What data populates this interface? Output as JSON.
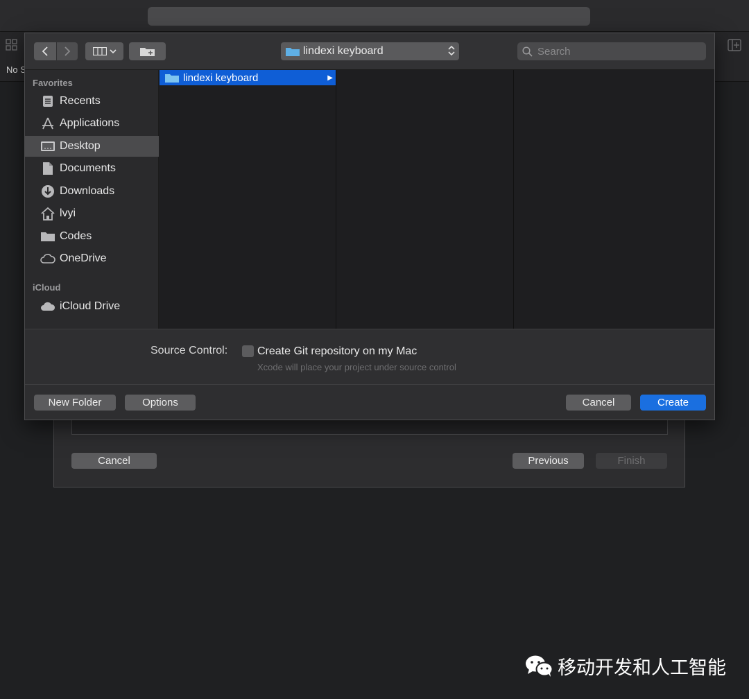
{
  "background_window": {
    "no_selection_text": "No S",
    "wizard": {
      "cancel_label": "Cancel",
      "previous_label": "Previous",
      "finish_label": "Finish"
    }
  },
  "panel": {
    "toolbar": {
      "back_icon": "chevron-left-icon",
      "forward_icon": "chevron-right-icon",
      "view_mode_icon": "column-view-icon",
      "new_folder_icon": "new-folder-icon",
      "path_popup_label": "lindexi keyboard",
      "search_placeholder": "Search"
    },
    "sidebar": {
      "sections": [
        {
          "heading": "Favorites",
          "items": [
            {
              "label": "Recents",
              "icon": "recents-icon",
              "selected": false
            },
            {
              "label": "Applications",
              "icon": "applications-icon",
              "selected": false
            },
            {
              "label": "Desktop",
              "icon": "desktop-icon",
              "selected": true
            },
            {
              "label": "Documents",
              "icon": "documents-icon",
              "selected": false
            },
            {
              "label": "Downloads",
              "icon": "downloads-icon",
              "selected": false
            },
            {
              "label": "lvyi",
              "icon": "home-icon",
              "selected": false
            },
            {
              "label": "Codes",
              "icon": "folder-icon",
              "selected": false
            },
            {
              "label": "OneDrive",
              "icon": "cloud-icon",
              "selected": false
            }
          ]
        },
        {
          "heading": "iCloud",
          "items": [
            {
              "label": "iCloud Drive",
              "icon": "icloud-icon",
              "selected": false
            }
          ]
        }
      ]
    },
    "browser": {
      "column1_items": [
        {
          "label": "lindexi keyboard",
          "selected": true,
          "has_children": true
        }
      ]
    },
    "source_control": {
      "label": "Source Control:",
      "checkbox_label": "Create Git repository on my Mac",
      "checked": false,
      "help_text": "Xcode will place your project under source control"
    },
    "footer": {
      "new_folder_label": "New Folder",
      "options_label": "Options",
      "cancel_label": "Cancel",
      "create_label": "Create"
    }
  },
  "watermark": {
    "text": "移动开发和人工智能",
    "icon": "wechat-icon"
  },
  "colors": {
    "accent": "#1a6fe0",
    "selection": "#0f5ed6",
    "background": "#1f2022"
  }
}
